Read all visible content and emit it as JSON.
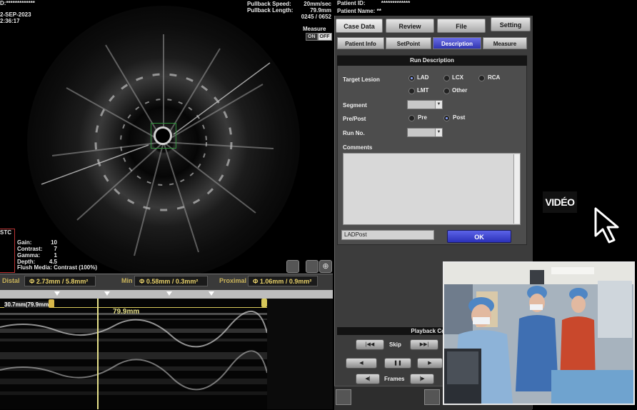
{
  "overlay": {
    "top_left_lines": [
      "D:*************",
      "2-SEP-2023",
      "2:36:17"
    ],
    "pullback_speed_label": "Pullback Speed:",
    "pullback_speed_value": "20mm/sec",
    "pullback_length_label": "Pullback Length:",
    "pullback_length_value": "79.9mm",
    "frame_counter": "0245 / 0652",
    "measure_label": "Measure",
    "measure_on": "ON",
    "measure_off": "OFF",
    "stc_label": "STC",
    "settings": [
      {
        "k": "Gain:",
        "v": "10"
      },
      {
        "k": "Contrast:",
        "v": "7"
      },
      {
        "k": "Gamma:",
        "v": "1"
      },
      {
        "k": "Depth:",
        "v": "4.5"
      }
    ],
    "flush_media": "Flush Media: Contrast (100%)"
  },
  "measurements": {
    "distal_label": "Distal",
    "distal_value": "Φ 2.73mm / 5.8mm²",
    "min_label": "Min",
    "min_value": "Φ 0.58mm / 0.3mm²",
    "proximal_label": "Proximal",
    "proximal_value": "Φ 1.06mm / 0.9mm²"
  },
  "longitudinal": {
    "left_readout": "30.7mm(79.9mm)",
    "length_readout": "79.9mm"
  },
  "patient": {
    "id_label": "Patient ID:",
    "id_value": "*************",
    "name_label": "Patient Name:",
    "name_value": "**"
  },
  "main_tabs": [
    "Case Data",
    "Review",
    "File",
    "Setting"
  ],
  "sub_tabs": [
    "Patient Info",
    "SetPoint",
    "Description",
    "Measure"
  ],
  "run_description": {
    "header": "Run Description",
    "target_lesion_label": "Target Lesion",
    "lesion_options": [
      "LAD",
      "LCX",
      "RCA",
      "LMT",
      "Other"
    ],
    "lesion_selected": "LAD",
    "segment_label": "Segment",
    "prepost_label": "Pre/Post",
    "prepost_options": [
      "Pre",
      "Post"
    ],
    "prepost_selected": "Post",
    "run_no_label": "Run No.",
    "comments_label": "Comments",
    "result_value": "LADPost",
    "ok_label": "OK"
  },
  "playback": {
    "header": "Playback Co",
    "skip_label": "Skip",
    "frames_label": "Frames"
  },
  "video": {
    "tag": "VIDÉO"
  },
  "colors": {
    "accent_blue": "#3035b0",
    "measurement_yellow": "#e8d16a",
    "lumen_box": "#2f8f3a"
  }
}
